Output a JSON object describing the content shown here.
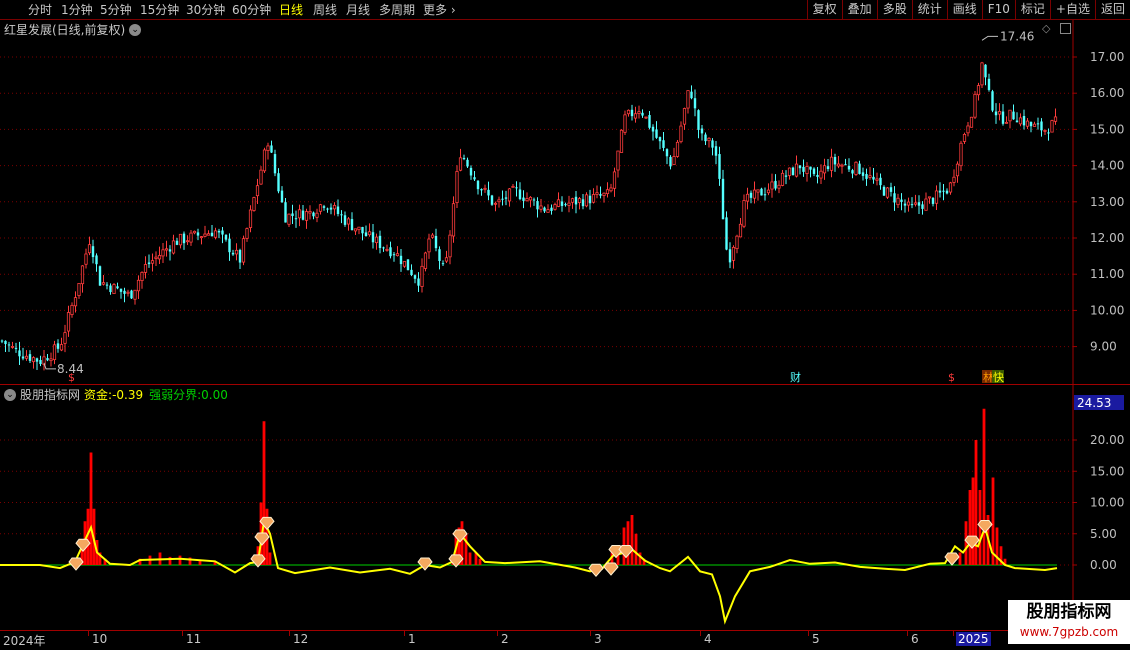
{
  "toolbar": {
    "periods": [
      "分时",
      "1分钟",
      "5分钟",
      "15分钟",
      "30分钟",
      "60分钟",
      "日线",
      "周线",
      "月线",
      "多周期",
      "更多"
    ],
    "active_period": "日线",
    "right_buttons": [
      "复权",
      "叠加",
      "多股",
      "统计",
      "画线",
      "F10",
      "标记",
      "+自选",
      "返回"
    ]
  },
  "main_chart": {
    "title": "红星发展(日线,前复权)",
    "price_ticks": [
      "17.00",
      "16.00",
      "15.00",
      "14.00",
      "13.00",
      "12.00",
      "11.00",
      "10.00",
      "9.00"
    ],
    "high_label": "17.46",
    "low_label": "8.44",
    "markers": [
      "$",
      "财",
      "$",
      "林",
      "快"
    ],
    "colors": {
      "up": "#ff3c3c",
      "down": "#54ffff",
      "grid": "#7a0000"
    }
  },
  "indicator": {
    "name": "股朋指标网",
    "fund_label": "资金:",
    "fund_value": "-0.39",
    "boundary_label": "强弱分界:",
    "boundary_value": "0.00",
    "current_value": "24.53",
    "ticks": [
      "20.00",
      "15.00",
      "10.00",
      "5.00",
      "0.00"
    ],
    "colors": {
      "bar": "#ff0000",
      "line": "#ffff00",
      "boundary": "#00d000"
    }
  },
  "time_axis": {
    "labels": [
      "2024年",
      "10",
      "11",
      "12",
      "1",
      "2",
      "3",
      "4",
      "5",
      "6",
      "2025"
    ]
  },
  "watermark": {
    "title": "股朋指标网",
    "url": "www.7gpzb.com"
  },
  "chart_data": [
    {
      "type": "candlestick",
      "title": "红星发展(日线,前复权)",
      "y_range": [
        8.2,
        17.9
      ],
      "x": [
        "2024年",
        "10",
        "11",
        "12",
        "1",
        "2",
        "3",
        "4",
        "5",
        "6",
        "2025"
      ],
      "anchors": [
        [
          0,
          9.2
        ],
        [
          15,
          8.9
        ],
        [
          40,
          8.6
        ],
        [
          60,
          9.0
        ],
        [
          75,
          10.4
        ],
        [
          90,
          12.0
        ],
        [
          100,
          10.8
        ],
        [
          130,
          10.4
        ],
        [
          145,
          11.2
        ],
        [
          175,
          11.9
        ],
        [
          215,
          12.2
        ],
        [
          240,
          11.4
        ],
        [
          255,
          13.2
        ],
        [
          268,
          14.7
        ],
        [
          275,
          13.8
        ],
        [
          285,
          12.6
        ],
        [
          310,
          12.7
        ],
        [
          325,
          13.0
        ],
        [
          345,
          12.5
        ],
        [
          370,
          12.0
        ],
        [
          395,
          11.6
        ],
        [
          420,
          10.8
        ],
        [
          430,
          12.1
        ],
        [
          445,
          11.0
        ],
        [
          460,
          14.4
        ],
        [
          478,
          13.5
        ],
        [
          495,
          12.9
        ],
        [
          515,
          13.3
        ],
        [
          545,
          12.8
        ],
        [
          575,
          13.0
        ],
        [
          610,
          13.2
        ],
        [
          625,
          15.3
        ],
        [
          640,
          15.6
        ],
        [
          660,
          14.6
        ],
        [
          672,
          14.0
        ],
        [
          690,
          16.2
        ],
        [
          700,
          14.8
        ],
        [
          715,
          14.5
        ],
        [
          720,
          13.4
        ],
        [
          728,
          11.3
        ],
        [
          745,
          13.0
        ],
        [
          770,
          13.4
        ],
        [
          800,
          14.0
        ],
        [
          815,
          13.6
        ],
        [
          830,
          14.1
        ],
        [
          860,
          13.9
        ],
        [
          880,
          13.4
        ],
        [
          910,
          12.8
        ],
        [
          935,
          13.1
        ],
        [
          950,
          13.4
        ],
        [
          963,
          14.8
        ],
        [
          975,
          15.8
        ],
        [
          982,
          16.8
        ],
        [
          990,
          15.8
        ],
        [
          1000,
          15.3
        ],
        [
          1015,
          15.4
        ],
        [
          1030,
          15.1
        ],
        [
          1045,
          15.0
        ],
        [
          1057,
          15.2
        ]
      ],
      "high": 17.46,
      "low": 8.44
    },
    {
      "type": "bar",
      "series_name": "资金",
      "y_range": [
        -10,
        24.53
      ],
      "bars": [
        [
          82,
          4
        ],
        [
          85,
          7
        ],
        [
          88,
          9
        ],
        [
          91,
          18
        ],
        [
          94,
          9
        ],
        [
          97,
          4
        ],
        [
          100,
          2
        ],
        [
          105,
          1
        ],
        [
          140,
          1
        ],
        [
          150,
          1.5
        ],
        [
          160,
          2
        ],
        [
          170,
          1.3
        ],
        [
          180,
          1.5
        ],
        [
          190,
          1.2
        ],
        [
          200,
          0.8
        ],
        [
          215,
          0.5
        ],
        [
          258,
          3
        ],
        [
          261,
          10
        ],
        [
          264,
          23
        ],
        [
          267,
          9
        ],
        [
          270,
          2
        ],
        [
          453,
          1
        ],
        [
          456,
          5
        ],
        [
          459,
          6
        ],
        [
          462,
          7
        ],
        [
          466,
          5
        ],
        [
          470,
          2
        ],
        [
          476,
          2
        ],
        [
          480,
          1
        ],
        [
          612,
          2
        ],
        [
          618,
          3
        ],
        [
          624,
          6
        ],
        [
          628,
          7
        ],
        [
          632,
          8
        ],
        [
          636,
          5
        ],
        [
          640,
          2
        ],
        [
          644,
          1
        ],
        [
          960,
          2
        ],
        [
          966,
          7
        ],
        [
          970,
          12
        ],
        [
          973,
          14
        ],
        [
          976,
          20
        ],
        [
          980,
          12
        ],
        [
          984,
          25
        ],
        [
          988,
          8
        ],
        [
          993,
          14
        ],
        [
          997,
          6
        ],
        [
          1001,
          3
        ],
        [
          1005,
          1
        ]
      ],
      "line": [
        [
          0,
          0
        ],
        [
          40,
          0
        ],
        [
          60,
          -0.5
        ],
        [
          75,
          0.5
        ],
        [
          85,
          4
        ],
        [
          91,
          6
        ],
        [
          97,
          2
        ],
        [
          110,
          0.2
        ],
        [
          130,
          0
        ],
        [
          140,
          0.8
        ],
        [
          180,
          1
        ],
        [
          215,
          0.6
        ],
        [
          235,
          -1.2
        ],
        [
          250,
          0.3
        ],
        [
          258,
          0.5
        ],
        [
          264,
          7
        ],
        [
          270,
          5
        ],
        [
          278,
          -0.5
        ],
        [
          295,
          -1.3
        ],
        [
          330,
          -0.4
        ],
        [
          360,
          -1.2
        ],
        [
          390,
          -0.6
        ],
        [
          410,
          -1.4
        ],
        [
          425,
          0
        ],
        [
          440,
          -0.4
        ],
        [
          452,
          0.5
        ],
        [
          460,
          5
        ],
        [
          470,
          3
        ],
        [
          485,
          0.5
        ],
        [
          505,
          0.3
        ],
        [
          540,
          0.6
        ],
        [
          575,
          -0.4
        ],
        [
          590,
          -1
        ],
        [
          602,
          -0.6
        ],
        [
          613,
          1.5
        ],
        [
          625,
          2
        ],
        [
          632,
          2.5
        ],
        [
          645,
          0.7
        ],
        [
          660,
          -0.5
        ],
        [
          670,
          -1
        ],
        [
          688,
          1.3
        ],
        [
          700,
          -1
        ],
        [
          712,
          -1.5
        ],
        [
          720,
          -5
        ],
        [
          725,
          -9
        ],
        [
          735,
          -5
        ],
        [
          750,
          -1
        ],
        [
          770,
          -0.3
        ],
        [
          790,
          0.8
        ],
        [
          810,
          0.2
        ],
        [
          835,
          0.4
        ],
        [
          860,
          -0.3
        ],
        [
          885,
          -0.6
        ],
        [
          905,
          -0.8
        ],
        [
          930,
          0.2
        ],
        [
          945,
          0.3
        ],
        [
          955,
          3
        ],
        [
          963,
          2
        ],
        [
          970,
          3.5
        ],
        [
          978,
          3
        ],
        [
          985,
          6
        ],
        [
          992,
          2
        ],
        [
          1005,
          0
        ],
        [
          1015,
          -0.5
        ],
        [
          1045,
          -0.8
        ],
        [
          1057,
          -0.5
        ]
      ],
      "diamonds": [
        [
          76,
          0
        ],
        [
          83,
          3
        ],
        [
          258,
          0.5
        ],
        [
          262,
          4
        ],
        [
          267,
          6.5
        ],
        [
          425,
          0
        ],
        [
          456,
          0.5
        ],
        [
          460,
          4.5
        ],
        [
          596,
          -1
        ],
        [
          611,
          -0.8
        ],
        [
          616,
          2
        ],
        [
          626,
          2
        ],
        [
          952,
          0.8
        ],
        [
          972,
          3.5
        ],
        [
          985,
          6
        ]
      ]
    }
  ]
}
